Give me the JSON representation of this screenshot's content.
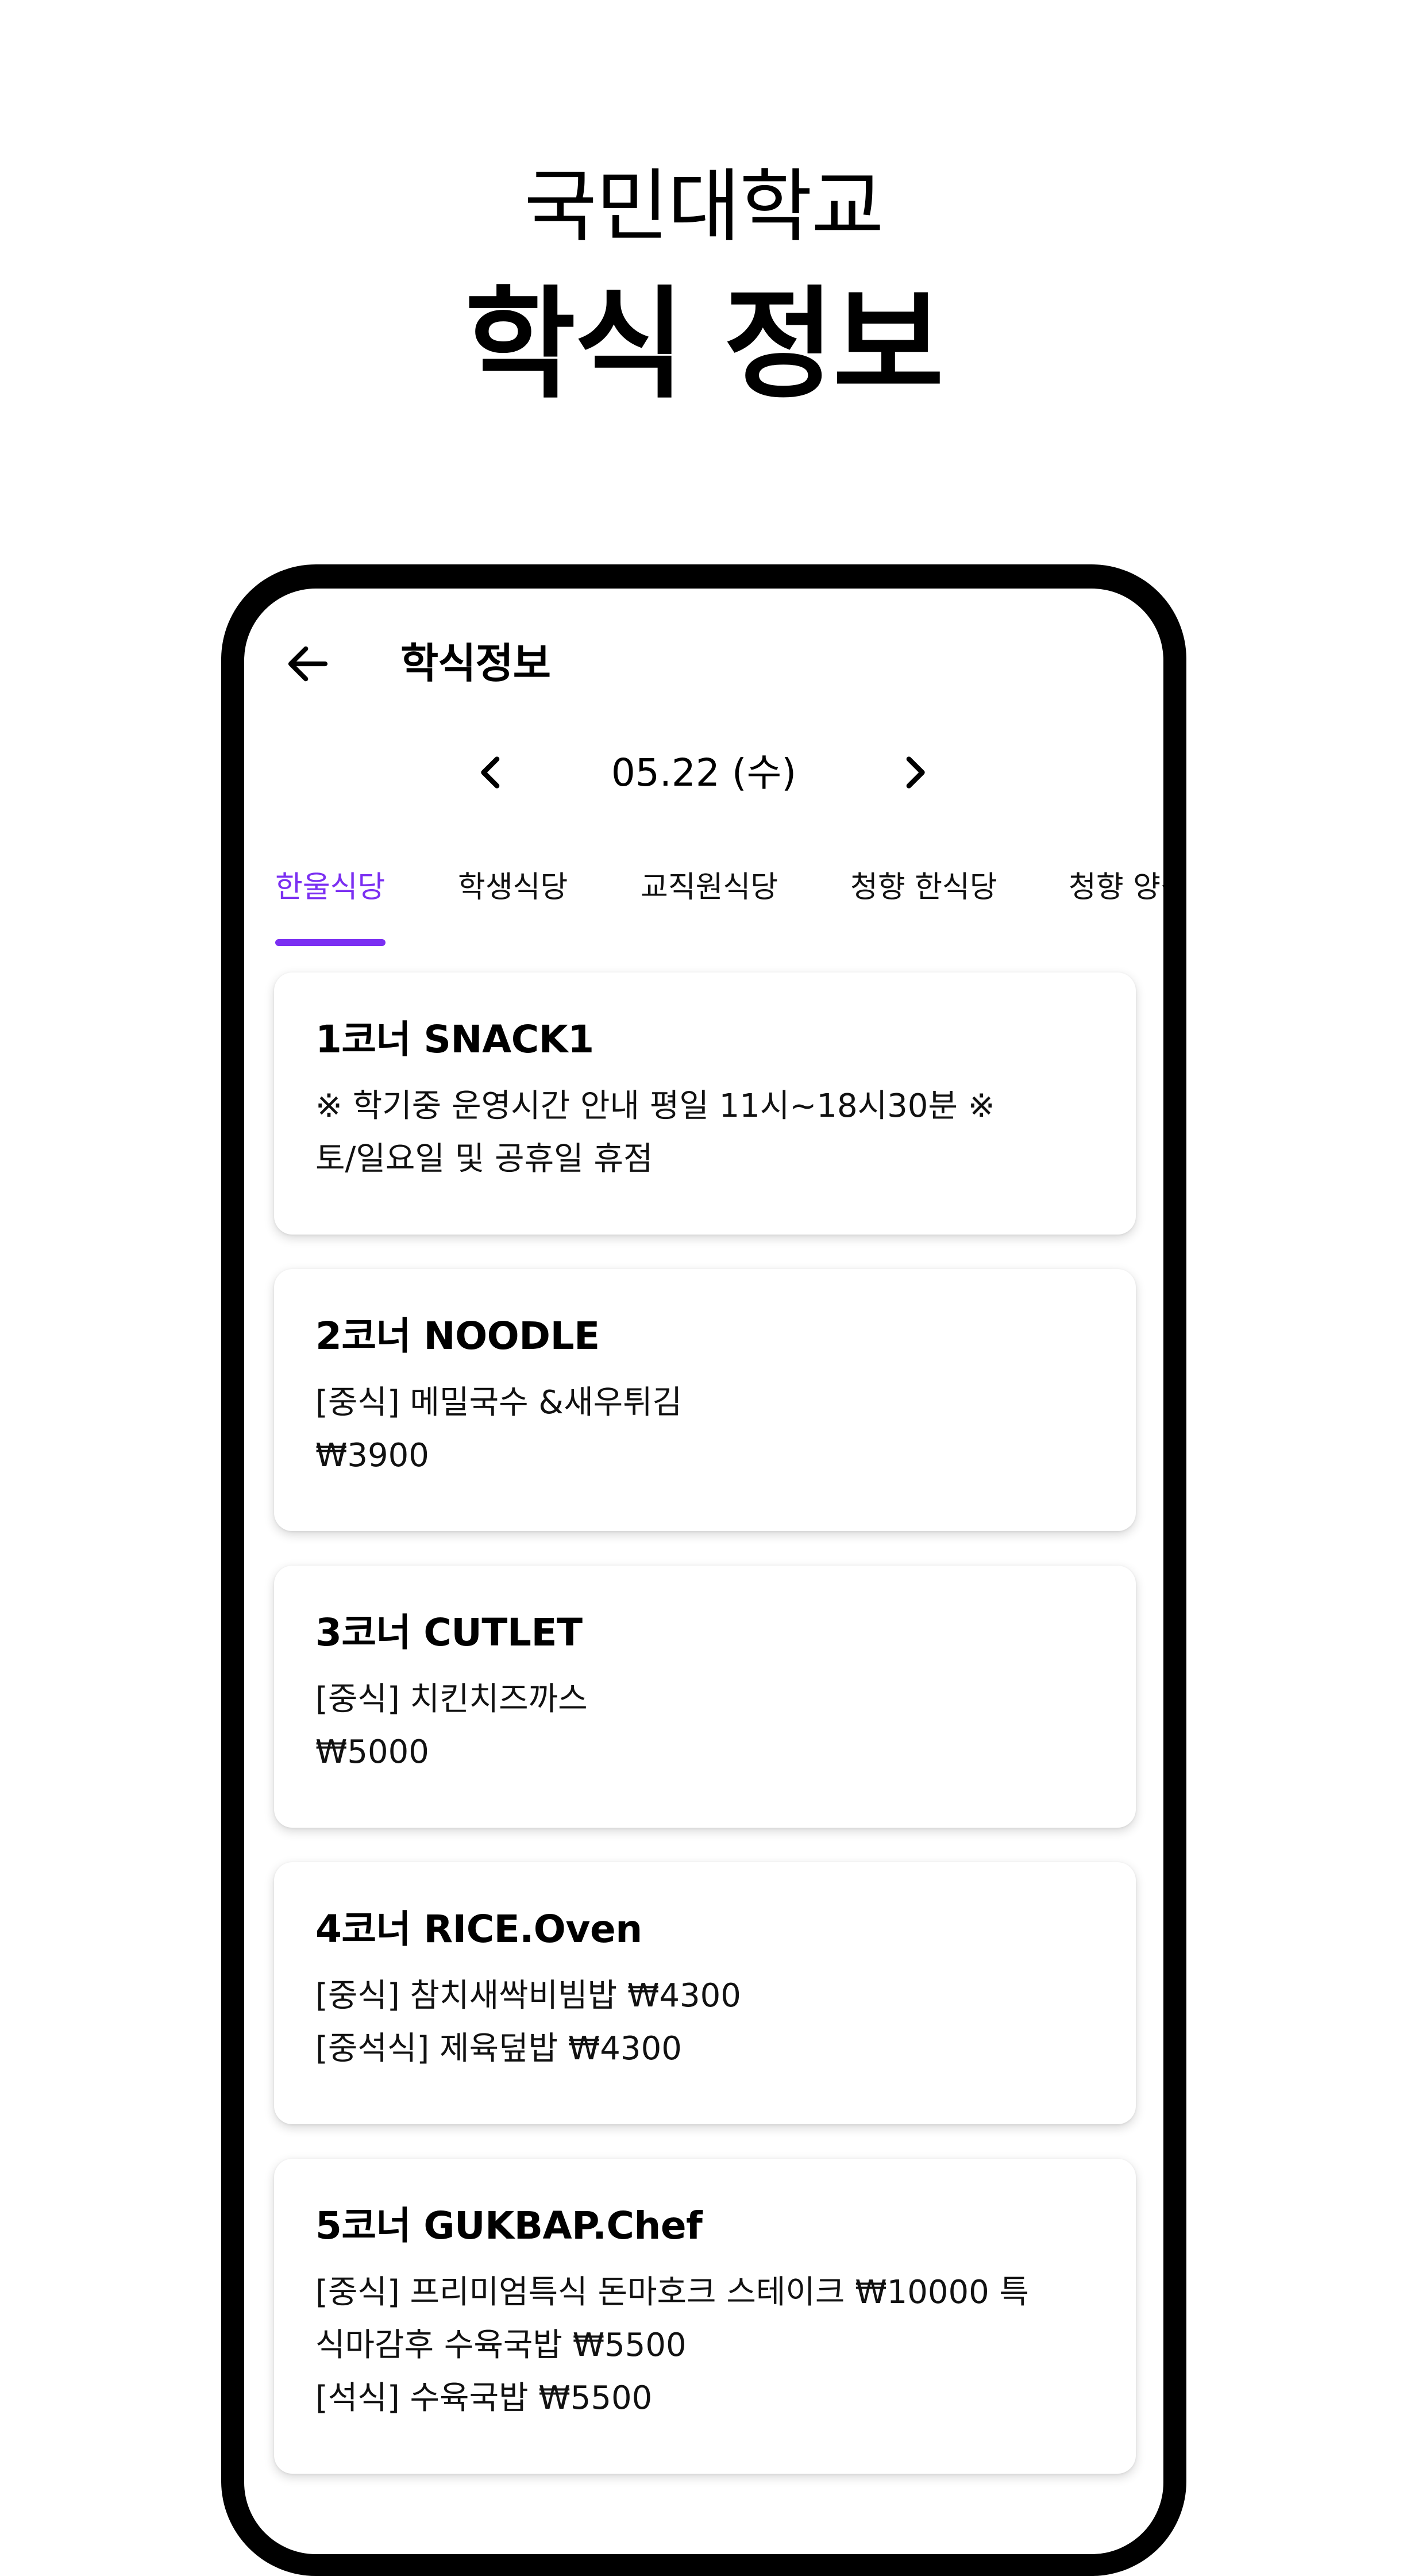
{
  "hero": {
    "subtitle": "국민대학교",
    "title": "학식 정보"
  },
  "appbar": {
    "back_icon": "arrow-left-icon",
    "title": "학식정보"
  },
  "date_nav": {
    "prev_icon": "chevron-left-icon",
    "date": "05.22 (수)",
    "next_icon": "chevron-right-icon"
  },
  "tabs": [
    {
      "label": "한울식당",
      "active": true
    },
    {
      "label": "학생식당",
      "active": false
    },
    {
      "label": "교직원식당",
      "active": false
    },
    {
      "label": "청향 한식당",
      "active": false
    },
    {
      "label": "청향 양식당",
      "active": false
    }
  ],
  "colors": {
    "accent": "#7b2ff2",
    "phone_frame": "#000000",
    "background": "#ffffff"
  },
  "cards": [
    {
      "title": "1코너 SNACK1",
      "lines": [
        "※ 학기중 운영시간 안내  평일 11시~18시30분 ※",
        "토/일요일 및 공휴일 휴점"
      ]
    },
    {
      "title": "2코너 NOODLE",
      "lines": [
        "[중식] 메밀국수 &새우튀김",
        "₩3900"
      ]
    },
    {
      "title": "3코너 CUTLET",
      "lines": [
        "[중식] 치킨치즈까스",
        "₩5000"
      ]
    },
    {
      "title": "4코너 RICE.Oven",
      "lines": [
        "[중식] 참치새싹비빔밥 ₩4300",
        "[중석식] 제육덮밥 ₩4300"
      ]
    },
    {
      "title": "5코너 GUKBAP.Chef",
      "lines": [
        "[중식] 프리미엄특식 돈마호크 스테이크 ₩10000  특",
        "식마감후 수육국밥 ₩5500",
        "[석식] 수육국밥 ₩5500"
      ]
    }
  ]
}
